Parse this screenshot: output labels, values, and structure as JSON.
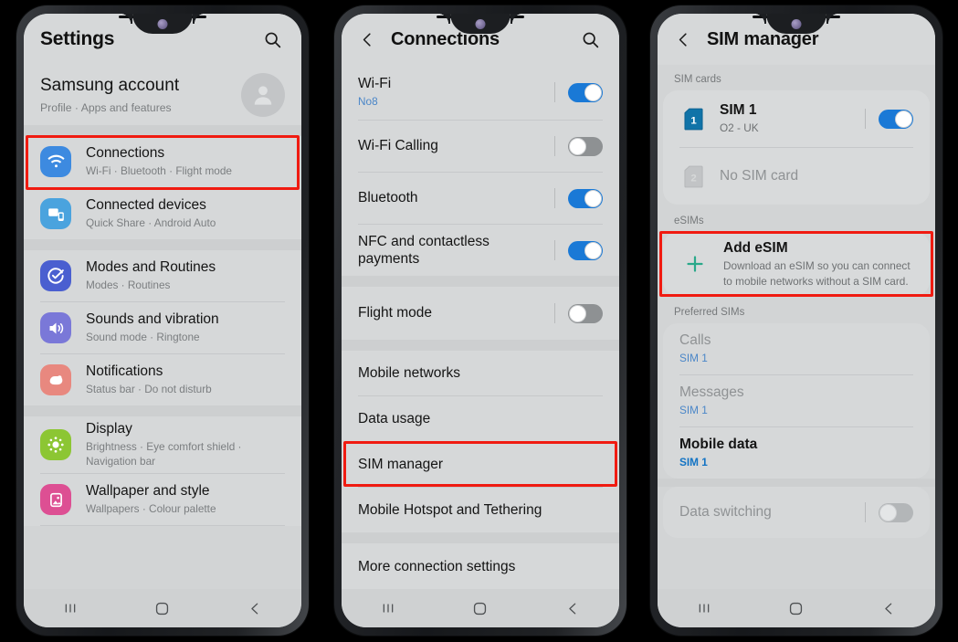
{
  "colors": {
    "toggle_on": "#1a79d6",
    "toggle_off": "#8e9193",
    "highlight": "#f01b11",
    "screen_bg": "#d6d8d9",
    "link_blue": "#1273c4",
    "plus_green": "#2aa98a"
  },
  "phone1": {
    "header": {
      "title": "Settings",
      "search_icon": "search-icon"
    },
    "account": {
      "title": "Samsung account",
      "subtitle": "Profile  ·  Apps and features",
      "avatar_icon": "person-avatar-icon"
    },
    "items": [
      {
        "title": "Connections",
        "subtitle": "Wi-Fi  ·  Bluetooth  ·  Flight mode",
        "icon": "wifi-icon",
        "color": "#3d8ae0",
        "highlighted": true
      },
      {
        "title": "Connected devices",
        "subtitle": "Quick Share  ·  Android Auto",
        "icon": "devices-icon",
        "color": "#4aa3de",
        "highlighted": false
      },
      {
        "title": "Modes and Routines",
        "subtitle": "Modes  ·  Routines",
        "icon": "check-circle-icon",
        "color": "#4a5fd0",
        "highlighted": false
      },
      {
        "title": "Sounds and vibration",
        "subtitle": "Sound mode  ·  Ringtone",
        "icon": "speaker-icon",
        "color": "#7a78d8",
        "highlighted": false
      },
      {
        "title": "Notifications",
        "subtitle": "Status bar  ·  Do not disturb",
        "icon": "notification-bell-icon",
        "color": "#e8887f",
        "highlighted": false
      },
      {
        "title": "Display",
        "subtitle": "Brightness  ·  Eye comfort shield  ·  Navigation bar",
        "icon": "brightness-icon",
        "color": "#8cc633",
        "highlighted": false
      },
      {
        "title": "Wallpaper and style",
        "subtitle": "Wallpapers  ·  Colour palette",
        "icon": "image-icon",
        "color": "#dd4f93",
        "highlighted": false
      }
    ],
    "navbar": {
      "recents_icon": "recents-icon",
      "home_icon": "home-icon",
      "back_icon": "back-icon"
    }
  },
  "phone2": {
    "header": {
      "title": "Connections",
      "back_icon": "back-arrow-icon",
      "search_icon": "search-icon"
    },
    "group1": [
      {
        "title": "Wi-Fi",
        "subtitle": "No8",
        "toggle": "on"
      },
      {
        "title": "Wi-Fi Calling",
        "subtitle": "",
        "toggle": "off"
      },
      {
        "title": "Bluetooth",
        "subtitle": "",
        "toggle": "on"
      },
      {
        "title": "NFC and contactless payments",
        "subtitle": "",
        "toggle": "on"
      }
    ],
    "group2": [
      {
        "title": "Flight mode",
        "subtitle": "",
        "toggle": "off"
      }
    ],
    "group3": [
      {
        "title": "Mobile networks",
        "highlighted": false
      },
      {
        "title": "Data usage",
        "highlighted": false
      },
      {
        "title": "SIM manager",
        "highlighted": true
      },
      {
        "title": "Mobile Hotspot and Tethering",
        "highlighted": false
      }
    ],
    "group4": [
      {
        "title": "More connection settings"
      }
    ],
    "navbar": {
      "recents_icon": "recents-icon",
      "home_icon": "home-icon",
      "back_icon": "back-icon"
    }
  },
  "phone3": {
    "header": {
      "title": "SIM manager",
      "back_icon": "back-arrow-icon"
    },
    "sim_cards_label": "SIM cards",
    "sim_cards": [
      {
        "title": "SIM 1",
        "subtitle": "O2 - UK",
        "icon": "sim-card-1-icon",
        "toggle": "on",
        "disabled": false
      },
      {
        "title": "No SIM card",
        "subtitle": "",
        "icon": "sim-card-2-icon",
        "toggle": null,
        "disabled": true
      }
    ],
    "esims_label": "eSIMs",
    "add_esim": {
      "title": "Add eSIM",
      "subtitle": "Download an eSIM so you can connect to mobile networks without a SIM card.",
      "icon": "plus-icon",
      "highlighted": true
    },
    "preferred_label": "Preferred SIMs",
    "preferred": [
      {
        "title": "Calls",
        "value": "SIM 1",
        "disabled": true
      },
      {
        "title": "Messages",
        "value": "SIM 1",
        "disabled": true
      },
      {
        "title": "Mobile data",
        "value": "SIM 1",
        "disabled": false
      }
    ],
    "data_switching": {
      "title": "Data switching",
      "toggle": "off"
    },
    "navbar": {
      "recents_icon": "recents-icon",
      "home_icon": "home-icon",
      "back_icon": "back-icon"
    }
  }
}
